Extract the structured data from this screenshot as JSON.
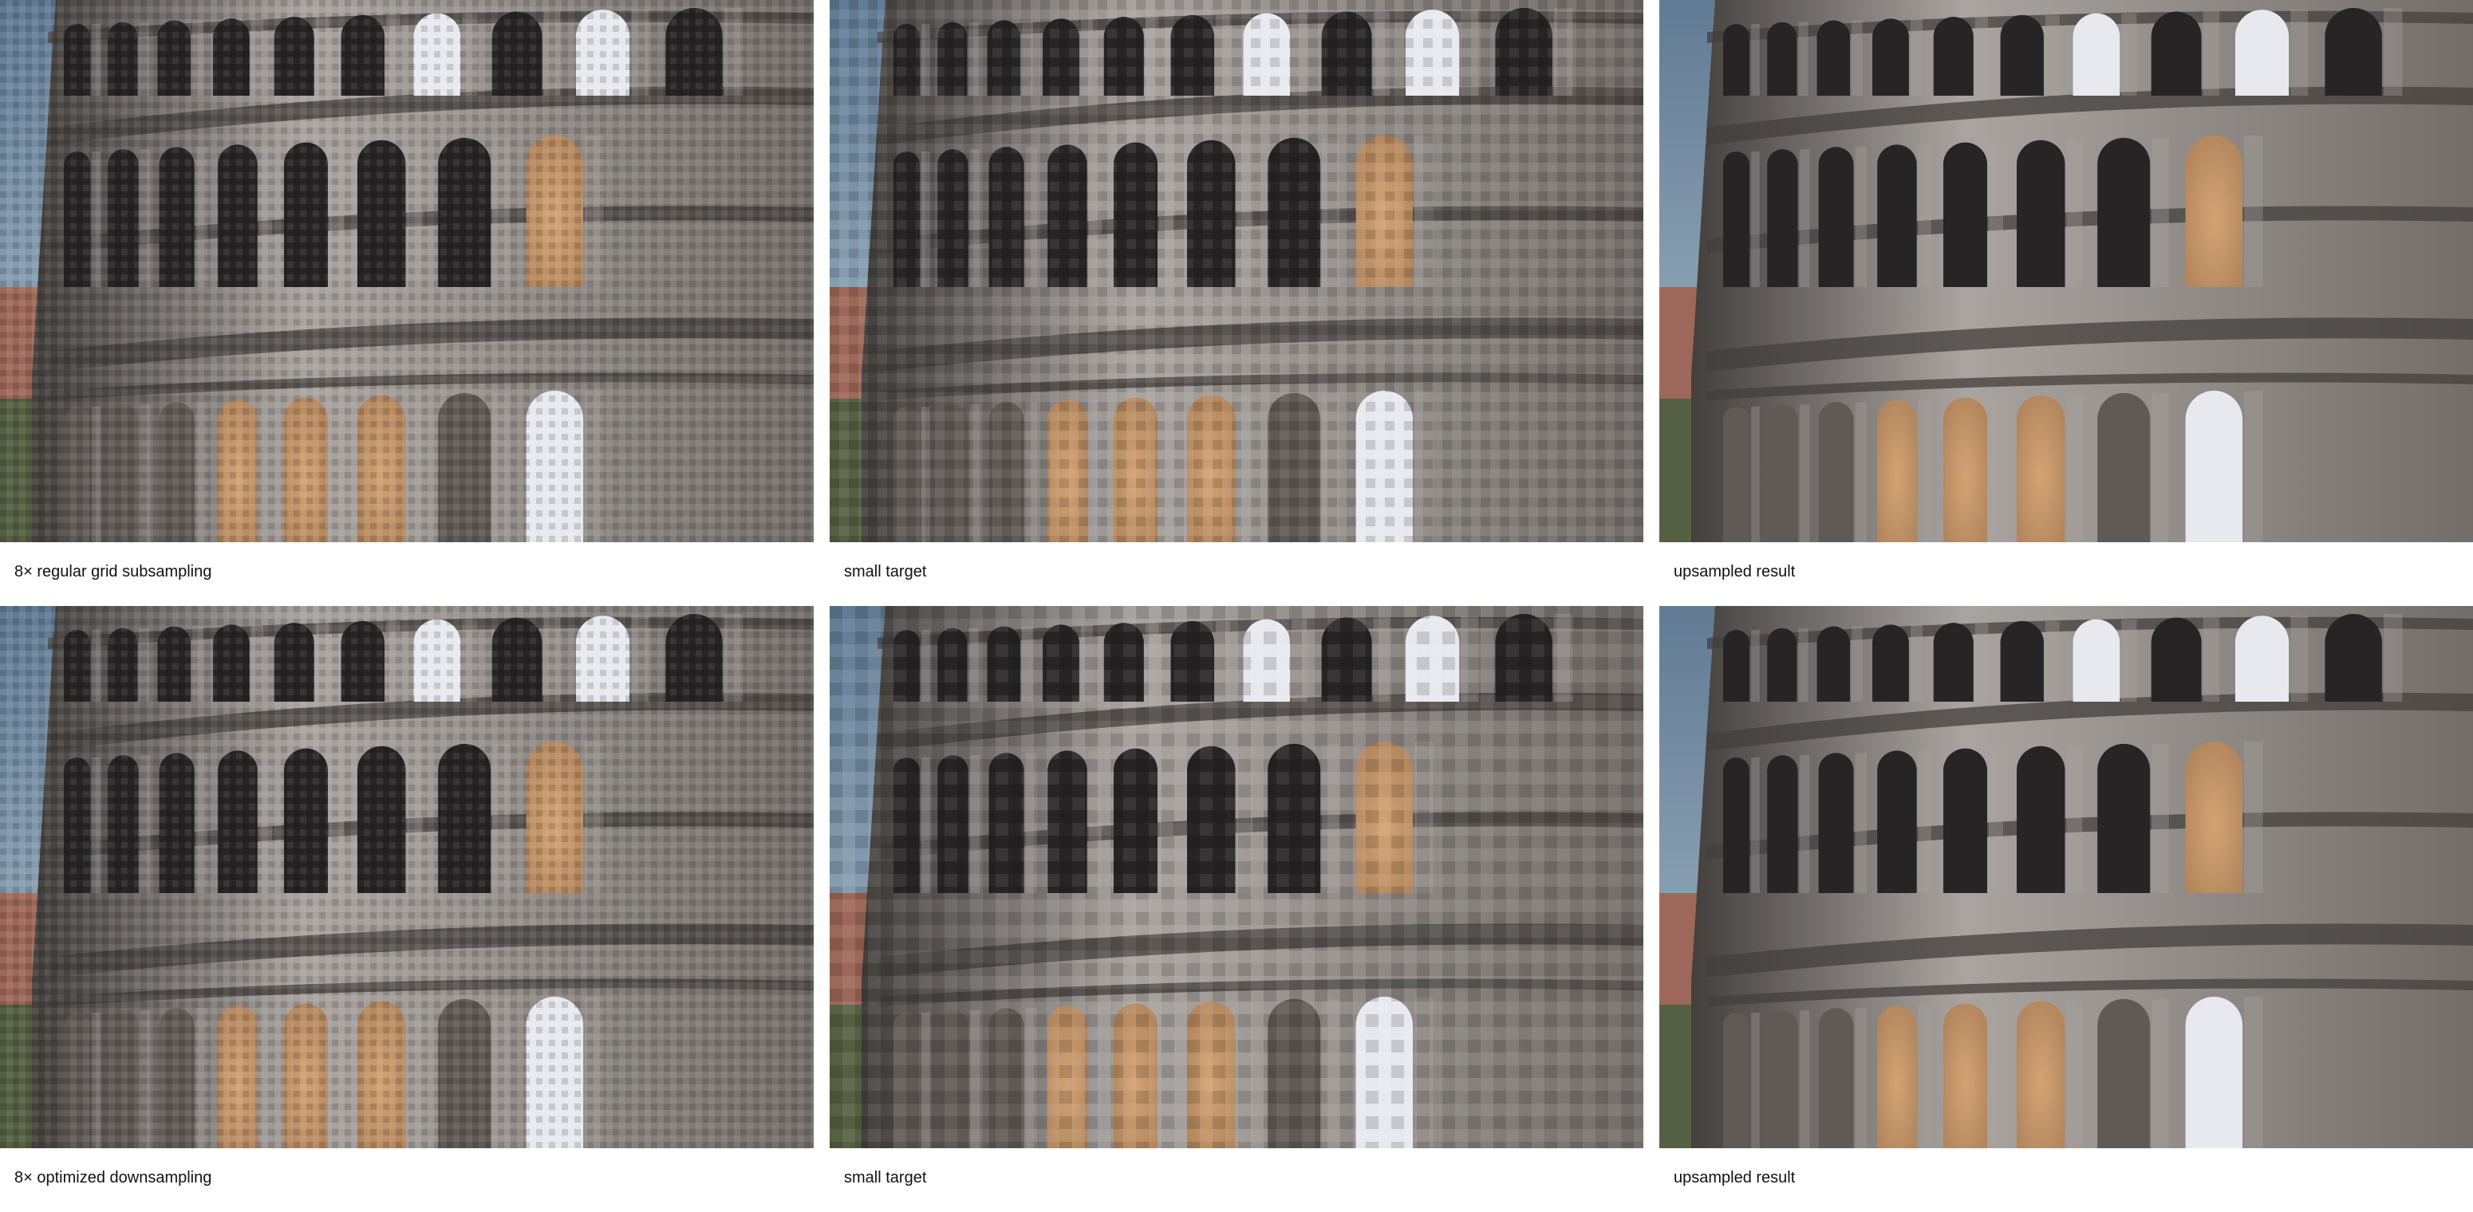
{
  "figure": {
    "rows": [
      {
        "panels": [
          {
            "caption": "8× regular grid subsampling",
            "pixelation": "blocky"
          },
          {
            "caption": "small target",
            "pixelation": "coarse"
          },
          {
            "caption": "upsampled result",
            "pixelation": "smooth"
          }
        ]
      },
      {
        "panels": [
          {
            "caption": "8× optimized downsampling",
            "pixelation": "blocky"
          },
          {
            "caption": "small target",
            "pixelation": "very-coarse"
          },
          {
            "caption": "upsampled result",
            "pixelation": "smooth"
          }
        ]
      }
    ]
  },
  "colors": {
    "sky": "#6f8aa3",
    "stone_light": "#a7a19d",
    "stone_mid": "#6e6864",
    "stone_dark": "#3c3836",
    "arch_shadow": "#1e1c1d",
    "arch_glow": "#b08257",
    "arch_sky": "#e6e9ef",
    "building_red": "#9a6253"
  }
}
